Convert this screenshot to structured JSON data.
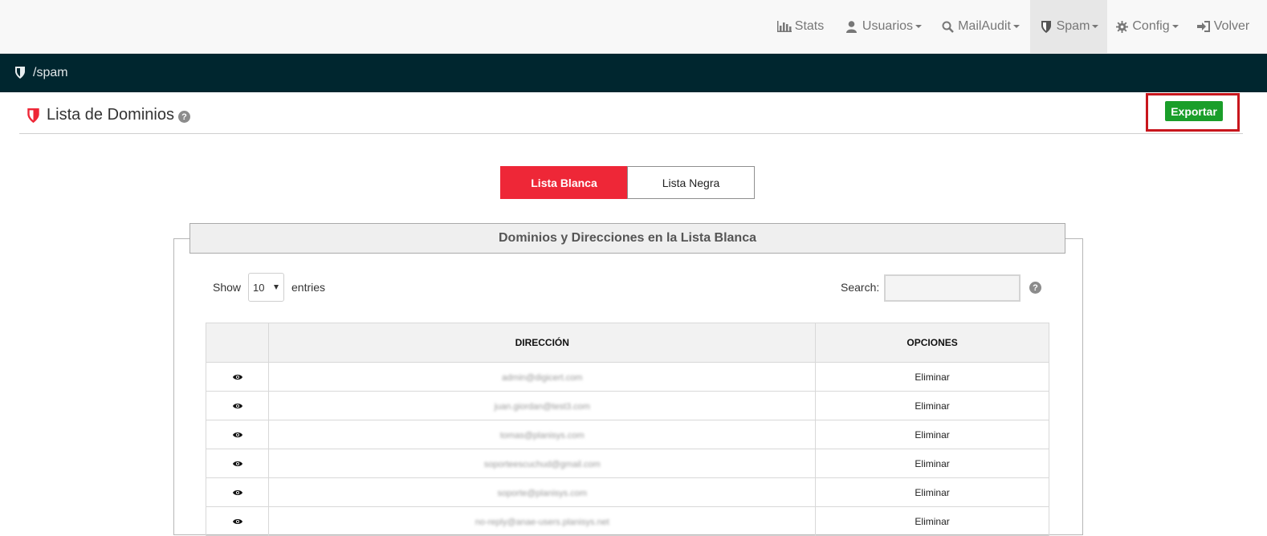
{
  "nav": {
    "items": [
      {
        "label": "Stats",
        "icon": "bar-chart-icon",
        "dropdown": false
      },
      {
        "label": "Usuarios",
        "icon": "user-icon",
        "dropdown": true
      },
      {
        "label": "MailAudit",
        "icon": "search-icon",
        "dropdown": true
      },
      {
        "label": "Spam",
        "icon": "shield-icon",
        "dropdown": true,
        "active": true
      },
      {
        "label": "Config",
        "icon": "gear-icon",
        "dropdown": true
      },
      {
        "label": "Volver",
        "icon": "sign-in-icon",
        "dropdown": false
      }
    ]
  },
  "breadcrumb": {
    "path": "/spam",
    "icon": "shield-icon"
  },
  "page": {
    "title": "Lista de Dominios",
    "help": "?",
    "export_label": "Exportar"
  },
  "tabs": [
    {
      "label": "Lista Blanca",
      "active": true
    },
    {
      "label": "Lista Negra",
      "active": false
    }
  ],
  "panel": {
    "title": "Dominios y Direcciones en la Lista Blanca",
    "show_label": "Show",
    "entries_value": "10",
    "entries_label": "entries",
    "search_label": "Search:",
    "search_value": "",
    "help": "?"
  },
  "table": {
    "headers": [
      "",
      "DIRECCIÓN",
      "OPCIONES"
    ],
    "rows": [
      {
        "direccion": "admin@digicert.com",
        "opcion": "Eliminar"
      },
      {
        "direccion": "juan.giordan@test3.com",
        "opcion": "Eliminar"
      },
      {
        "direccion": "tomas@planisys.com",
        "opcion": "Eliminar"
      },
      {
        "direccion": "soporteescuchud@gmail.com",
        "opcion": "Eliminar"
      },
      {
        "direccion": "soporte@planisys.com",
        "opcion": "Eliminar"
      },
      {
        "direccion": "no-reply@anae-users.planisys.net",
        "opcion": "Eliminar"
      }
    ]
  },
  "colors": {
    "nav_bg": "#f8f8f8",
    "breadcrumb_bg": "#00262f",
    "accent_red": "#ee2737",
    "export_green": "#1a9e2a",
    "highlight_red": "#c8161d"
  }
}
